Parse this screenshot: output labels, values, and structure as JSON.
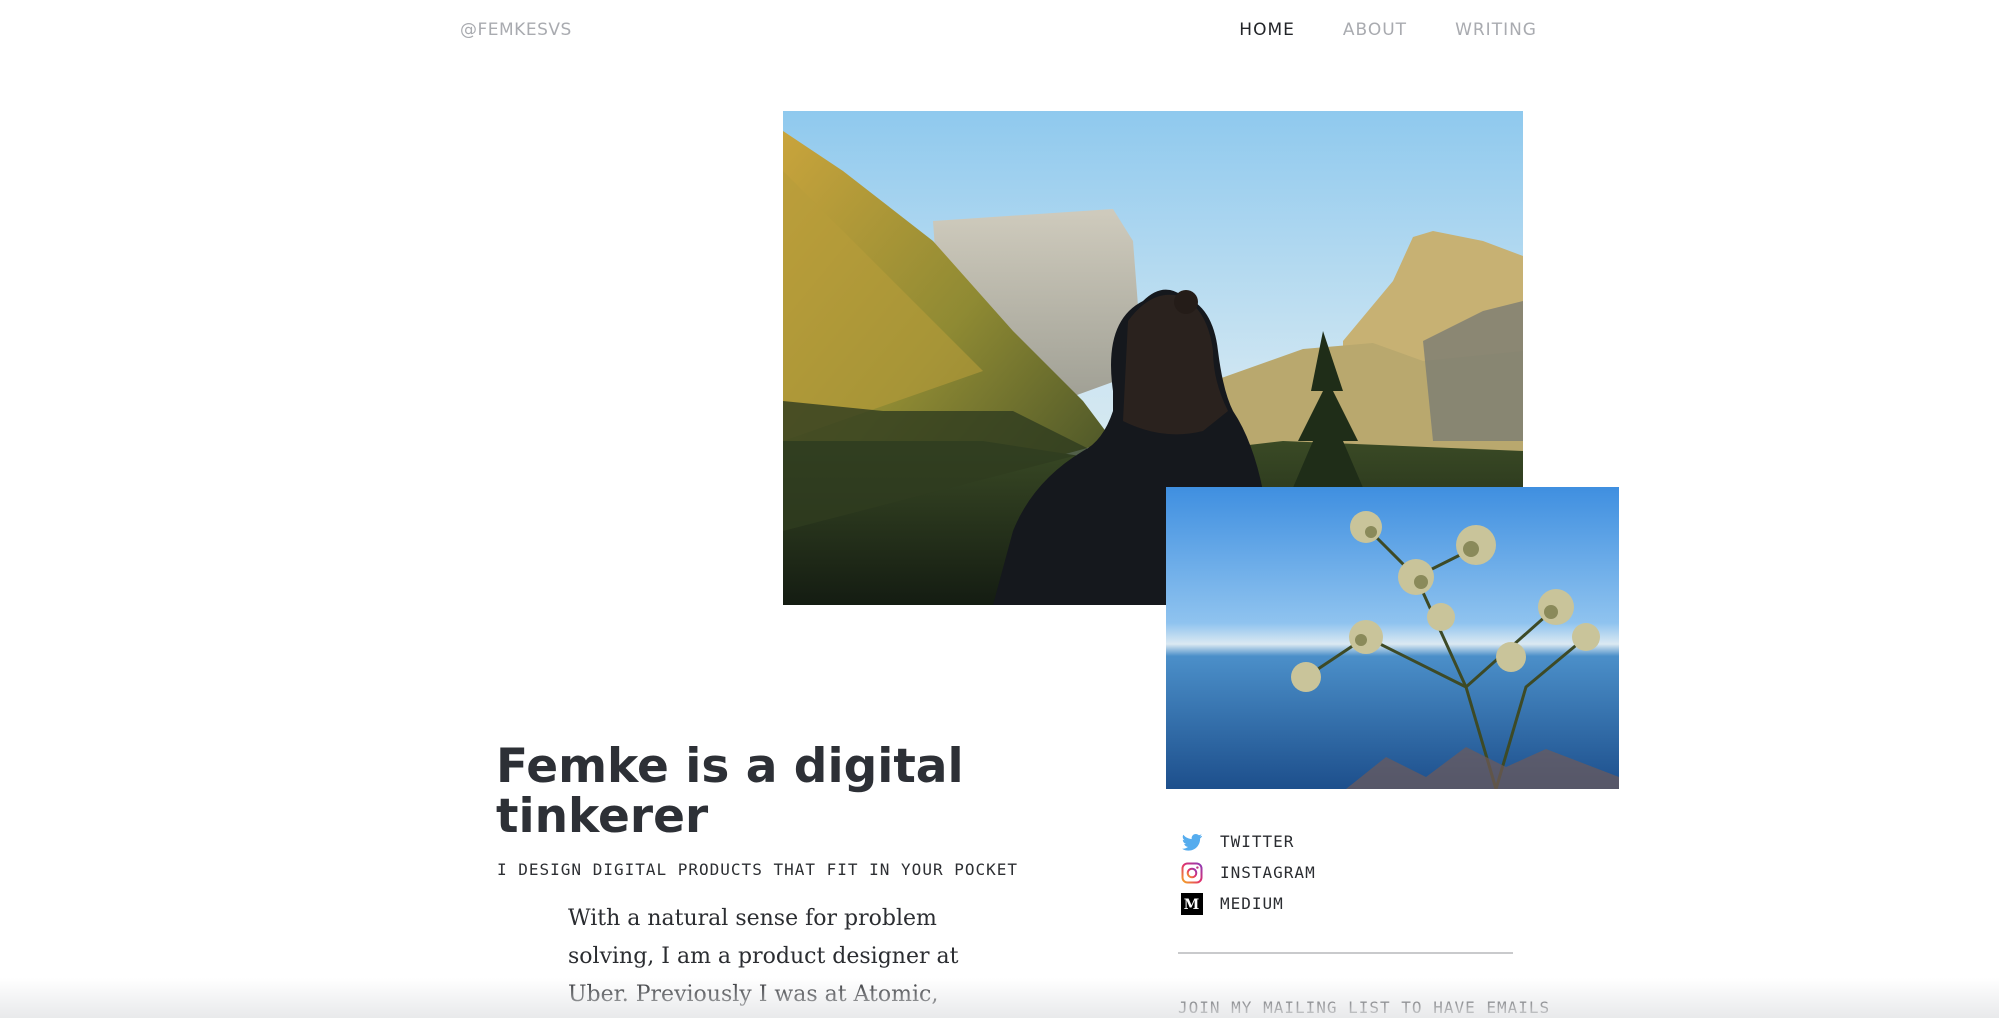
{
  "header": {
    "handle": "@FEMKESVS",
    "nav": [
      {
        "label": "HOME",
        "active": true
      },
      {
        "label": "ABOUT",
        "active": false
      },
      {
        "label": "WRITING",
        "active": false
      }
    ]
  },
  "hero": {
    "headline": "Femke is a digital tinkerer",
    "tagline": "I DESIGN DIGITAL PRODUCTS THAT FIT IN YOUR POCKET",
    "bio": "With a natural sense for problem solving, I am a product designer at Uber. Previously I was at Atomic, helping"
  },
  "social": {
    "links": [
      {
        "label": "TWITTER",
        "icon": "twitter-icon"
      },
      {
        "label": "INSTAGRAM",
        "icon": "instagram-icon"
      },
      {
        "label": "MEDIUM",
        "icon": "medium-icon"
      }
    ]
  },
  "mailing": {
    "text": "JOIN MY MAILING LIST TO HAVE EMAILS"
  },
  "colors": {
    "text": "#2d3036",
    "nav_inactive": "#a9abb0",
    "twitter": "#55acee",
    "medium": "#000000"
  }
}
